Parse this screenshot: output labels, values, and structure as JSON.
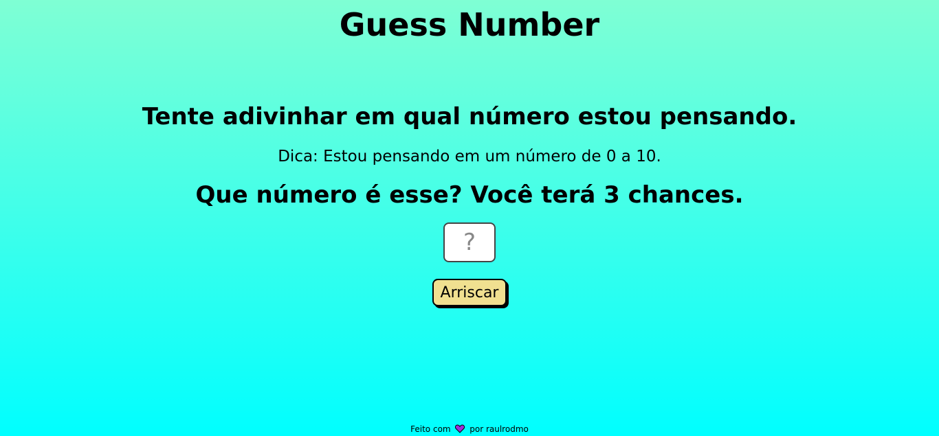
{
  "header": {
    "title": "Guess Number"
  },
  "main": {
    "headline": "Tente adivinhar em qual número estou pensando.",
    "hint": "Dica: Estou pensando em um número de 0 a 10.",
    "question": "Que número é esse? Você terá 3 chances.",
    "input": {
      "placeholder": "?",
      "value": ""
    },
    "button_label": "Arriscar"
  },
  "footer": {
    "prefix": "Feito com",
    "icon": "heart-icon",
    "suffix": "por raulrodmo"
  },
  "colors": {
    "background_top": "#7fffd4",
    "background_bottom": "#00ffff",
    "button": "#f0e090",
    "heart": "#9b30d9"
  }
}
